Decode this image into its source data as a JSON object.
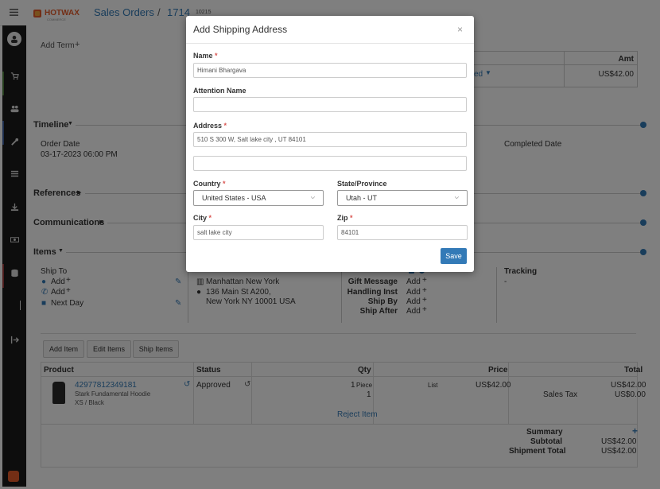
{
  "header": {
    "logo": "HOTWAX",
    "logo_sub": "COMMERCE",
    "title": "Sales Orders",
    "separator": "/",
    "order_no": "1714",
    "order_id": "10215"
  },
  "summary_panel": {
    "add_term": "Add Term",
    "amt_header": "Amt",
    "status_tail": "ed",
    "amt_value": "US$42.00"
  },
  "timeline": {
    "title": "Timeline",
    "order_date_label": "Order Date",
    "order_date_value": "03-17-2023 06:00 PM",
    "completed_date_label": "Completed Date"
  },
  "references": {
    "title": "References"
  },
  "communications": {
    "title": "Communications"
  },
  "items_section": {
    "title": "Items",
    "ship_to": "Ship To",
    "add1": "Add",
    "add2": "Add",
    "next_day": "Next Day",
    "ship_from_1": "Manhattan New York",
    "ship_from_2": "136 Main St A200,",
    "ship_from_3": "New York NY 10001 USA",
    "gift_message": "Gift Message",
    "handling_inst": "Handling Inst",
    "ship_by": "Ship By",
    "ship_after": "Ship After",
    "add_gift": "Add",
    "add_handling": "Add",
    "add_shipby": "Add",
    "add_shipafter": "Add",
    "tracking": "Tracking",
    "tracking_value": "-",
    "add_item": "Add Item",
    "edit_items": "Edit Items",
    "ship_items": "Ship Items"
  },
  "table": {
    "headers": {
      "product": "Product",
      "status": "Status",
      "qty": "Qty",
      "price": "Price",
      "total": "Total"
    },
    "row": {
      "product_id": "42977812349181",
      "product_name": "Stark Fundamental Hoodie",
      "product_variant": "XS / Black",
      "status": "Approved",
      "qty": "1",
      "qty_unit": "Piece",
      "qty_2": "1",
      "list": "List",
      "price": "US$42.00",
      "total": "US$42.00",
      "sales_tax_label": "Sales Tax",
      "sales_tax": "US$0.00",
      "reject": "Reject Item"
    },
    "summary_label": "Summary",
    "subtotal_label": "Subtotal",
    "subtotal": "US$42.00",
    "shipment_total_label": "Shipment Total",
    "shipment_total": "US$42.00"
  },
  "modal": {
    "title": "Add Shipping Address",
    "close": "×",
    "name_label": "Name",
    "name_value": "Himani Bhargava",
    "attention_label": "Attention Name",
    "attention_value": "",
    "address_label": "Address",
    "address_value": "510 S 300 W, Salt  lake city , UT 84101",
    "address2_value": "",
    "country_label": "Country",
    "country_value": "United States - USA",
    "state_label": "State/Province",
    "state_value": "Utah - UT",
    "city_label": "City",
    "city_value": "salt lake city",
    "zip_label": "Zip",
    "zip_value": "84101",
    "required_mark": "*",
    "save": "Save"
  },
  "colors": {
    "accent": "#337ab7",
    "overlay": "rgba(0,0,0,0.5)",
    "sidebar": "#1b1b1b",
    "required": "#d9534f"
  }
}
